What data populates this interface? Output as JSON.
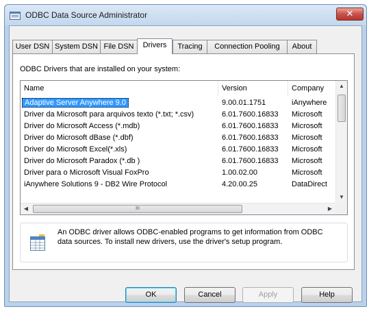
{
  "window": {
    "title": "ODBC Data Source Administrator",
    "close_glyph": "✕"
  },
  "tabs": [
    {
      "label": "User DSN"
    },
    {
      "label": "System DSN"
    },
    {
      "label": "File DSN"
    },
    {
      "label": "Drivers",
      "active": true
    },
    {
      "label": "Tracing"
    },
    {
      "label": "Connection Pooling"
    },
    {
      "label": "About"
    }
  ],
  "panel": {
    "heading": "ODBC Drivers that are installed on your system:",
    "columns": {
      "name": "Name",
      "version": "Version",
      "company": "Company"
    },
    "drivers": [
      {
        "name": "Adaptive Server Anywhere 9.0",
        "version": "9.00.01.1751",
        "company": "iAnywhere",
        "selected": true
      },
      {
        "name": "Driver da Microsoft para arquivos texto (*.txt; *.csv)",
        "version": "6.01.7600.16833",
        "company": "Microsoft"
      },
      {
        "name": "Driver do Microsoft Access (*.mdb)",
        "version": "6.01.7600.16833",
        "company": "Microsoft"
      },
      {
        "name": "Driver do Microsoft dBase (*.dbf)",
        "version": "6.01.7600.16833",
        "company": "Microsoft"
      },
      {
        "name": "Driver do Microsoft Excel(*.xls)",
        "version": "6.01.7600.16833",
        "company": "Microsoft"
      },
      {
        "name": "Driver do Microsoft Paradox (*.db )",
        "version": "6.01.7600.16833",
        "company": "Microsoft"
      },
      {
        "name": "Driver para o Microsoft Visual FoxPro",
        "version": "1.00.02.00",
        "company": "Microsoft"
      },
      {
        "name": "iAnywhere Solutions 9 - DB2 Wire Protocol",
        "version": "4.20.00.25",
        "company": "DataDirect"
      }
    ],
    "hscroll_grip": "III",
    "info_text": "An ODBC driver allows ODBC-enabled programs to get information from ODBC data sources.  To install new drivers, use the driver's setup program."
  },
  "buttons": {
    "ok": "OK",
    "cancel": "Cancel",
    "apply": "Apply",
    "help": "Help"
  },
  "icons": {
    "title": "odbc-admin-icon",
    "info": "table-info-icon"
  }
}
